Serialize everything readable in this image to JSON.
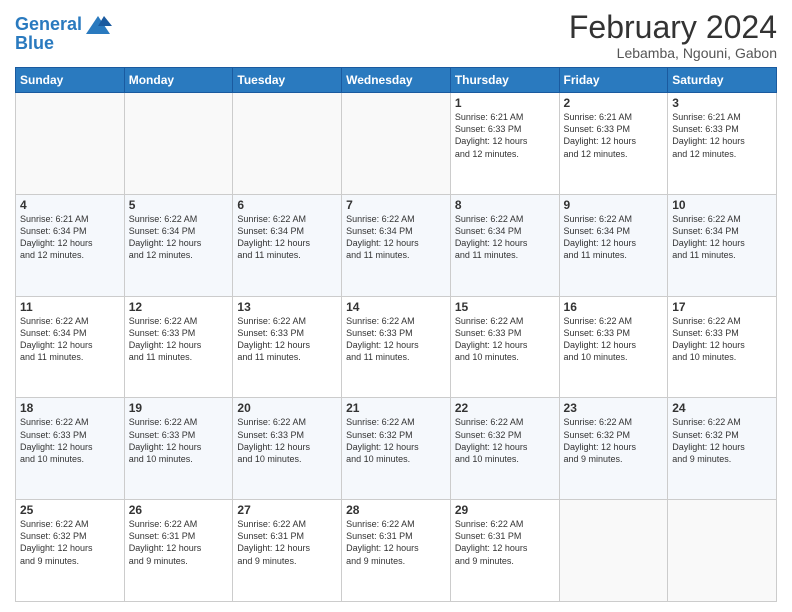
{
  "logo": {
    "line1": "General",
    "line2": "Blue"
  },
  "title": "February 2024",
  "subtitle": "Lebamba, Ngouni, Gabon",
  "days_header": [
    "Sunday",
    "Monday",
    "Tuesday",
    "Wednesday",
    "Thursday",
    "Friday",
    "Saturday"
  ],
  "weeks": [
    [
      {
        "num": "",
        "detail": ""
      },
      {
        "num": "",
        "detail": ""
      },
      {
        "num": "",
        "detail": ""
      },
      {
        "num": "",
        "detail": ""
      },
      {
        "num": "1",
        "detail": "Sunrise: 6:21 AM\nSunset: 6:33 PM\nDaylight: 12 hours\nand 12 minutes."
      },
      {
        "num": "2",
        "detail": "Sunrise: 6:21 AM\nSunset: 6:33 PM\nDaylight: 12 hours\nand 12 minutes."
      },
      {
        "num": "3",
        "detail": "Sunrise: 6:21 AM\nSunset: 6:33 PM\nDaylight: 12 hours\nand 12 minutes."
      }
    ],
    [
      {
        "num": "4",
        "detail": "Sunrise: 6:21 AM\nSunset: 6:34 PM\nDaylight: 12 hours\nand 12 minutes."
      },
      {
        "num": "5",
        "detail": "Sunrise: 6:22 AM\nSunset: 6:34 PM\nDaylight: 12 hours\nand 12 minutes."
      },
      {
        "num": "6",
        "detail": "Sunrise: 6:22 AM\nSunset: 6:34 PM\nDaylight: 12 hours\nand 11 minutes."
      },
      {
        "num": "7",
        "detail": "Sunrise: 6:22 AM\nSunset: 6:34 PM\nDaylight: 12 hours\nand 11 minutes."
      },
      {
        "num": "8",
        "detail": "Sunrise: 6:22 AM\nSunset: 6:34 PM\nDaylight: 12 hours\nand 11 minutes."
      },
      {
        "num": "9",
        "detail": "Sunrise: 6:22 AM\nSunset: 6:34 PM\nDaylight: 12 hours\nand 11 minutes."
      },
      {
        "num": "10",
        "detail": "Sunrise: 6:22 AM\nSunset: 6:34 PM\nDaylight: 12 hours\nand 11 minutes."
      }
    ],
    [
      {
        "num": "11",
        "detail": "Sunrise: 6:22 AM\nSunset: 6:34 PM\nDaylight: 12 hours\nand 11 minutes."
      },
      {
        "num": "12",
        "detail": "Sunrise: 6:22 AM\nSunset: 6:33 PM\nDaylight: 12 hours\nand 11 minutes."
      },
      {
        "num": "13",
        "detail": "Sunrise: 6:22 AM\nSunset: 6:33 PM\nDaylight: 12 hours\nand 11 minutes."
      },
      {
        "num": "14",
        "detail": "Sunrise: 6:22 AM\nSunset: 6:33 PM\nDaylight: 12 hours\nand 11 minutes."
      },
      {
        "num": "15",
        "detail": "Sunrise: 6:22 AM\nSunset: 6:33 PM\nDaylight: 12 hours\nand 10 minutes."
      },
      {
        "num": "16",
        "detail": "Sunrise: 6:22 AM\nSunset: 6:33 PM\nDaylight: 12 hours\nand 10 minutes."
      },
      {
        "num": "17",
        "detail": "Sunrise: 6:22 AM\nSunset: 6:33 PM\nDaylight: 12 hours\nand 10 minutes."
      }
    ],
    [
      {
        "num": "18",
        "detail": "Sunrise: 6:22 AM\nSunset: 6:33 PM\nDaylight: 12 hours\nand 10 minutes."
      },
      {
        "num": "19",
        "detail": "Sunrise: 6:22 AM\nSunset: 6:33 PM\nDaylight: 12 hours\nand 10 minutes."
      },
      {
        "num": "20",
        "detail": "Sunrise: 6:22 AM\nSunset: 6:33 PM\nDaylight: 12 hours\nand 10 minutes."
      },
      {
        "num": "21",
        "detail": "Sunrise: 6:22 AM\nSunset: 6:32 PM\nDaylight: 12 hours\nand 10 minutes."
      },
      {
        "num": "22",
        "detail": "Sunrise: 6:22 AM\nSunset: 6:32 PM\nDaylight: 12 hours\nand 10 minutes."
      },
      {
        "num": "23",
        "detail": "Sunrise: 6:22 AM\nSunset: 6:32 PM\nDaylight: 12 hours\nand 9 minutes."
      },
      {
        "num": "24",
        "detail": "Sunrise: 6:22 AM\nSunset: 6:32 PM\nDaylight: 12 hours\nand 9 minutes."
      }
    ],
    [
      {
        "num": "25",
        "detail": "Sunrise: 6:22 AM\nSunset: 6:32 PM\nDaylight: 12 hours\nand 9 minutes."
      },
      {
        "num": "26",
        "detail": "Sunrise: 6:22 AM\nSunset: 6:31 PM\nDaylight: 12 hours\nand 9 minutes."
      },
      {
        "num": "27",
        "detail": "Sunrise: 6:22 AM\nSunset: 6:31 PM\nDaylight: 12 hours\nand 9 minutes."
      },
      {
        "num": "28",
        "detail": "Sunrise: 6:22 AM\nSunset: 6:31 PM\nDaylight: 12 hours\nand 9 minutes."
      },
      {
        "num": "29",
        "detail": "Sunrise: 6:22 AM\nSunset: 6:31 PM\nDaylight: 12 hours\nand 9 minutes."
      },
      {
        "num": "",
        "detail": ""
      },
      {
        "num": "",
        "detail": ""
      }
    ]
  ]
}
